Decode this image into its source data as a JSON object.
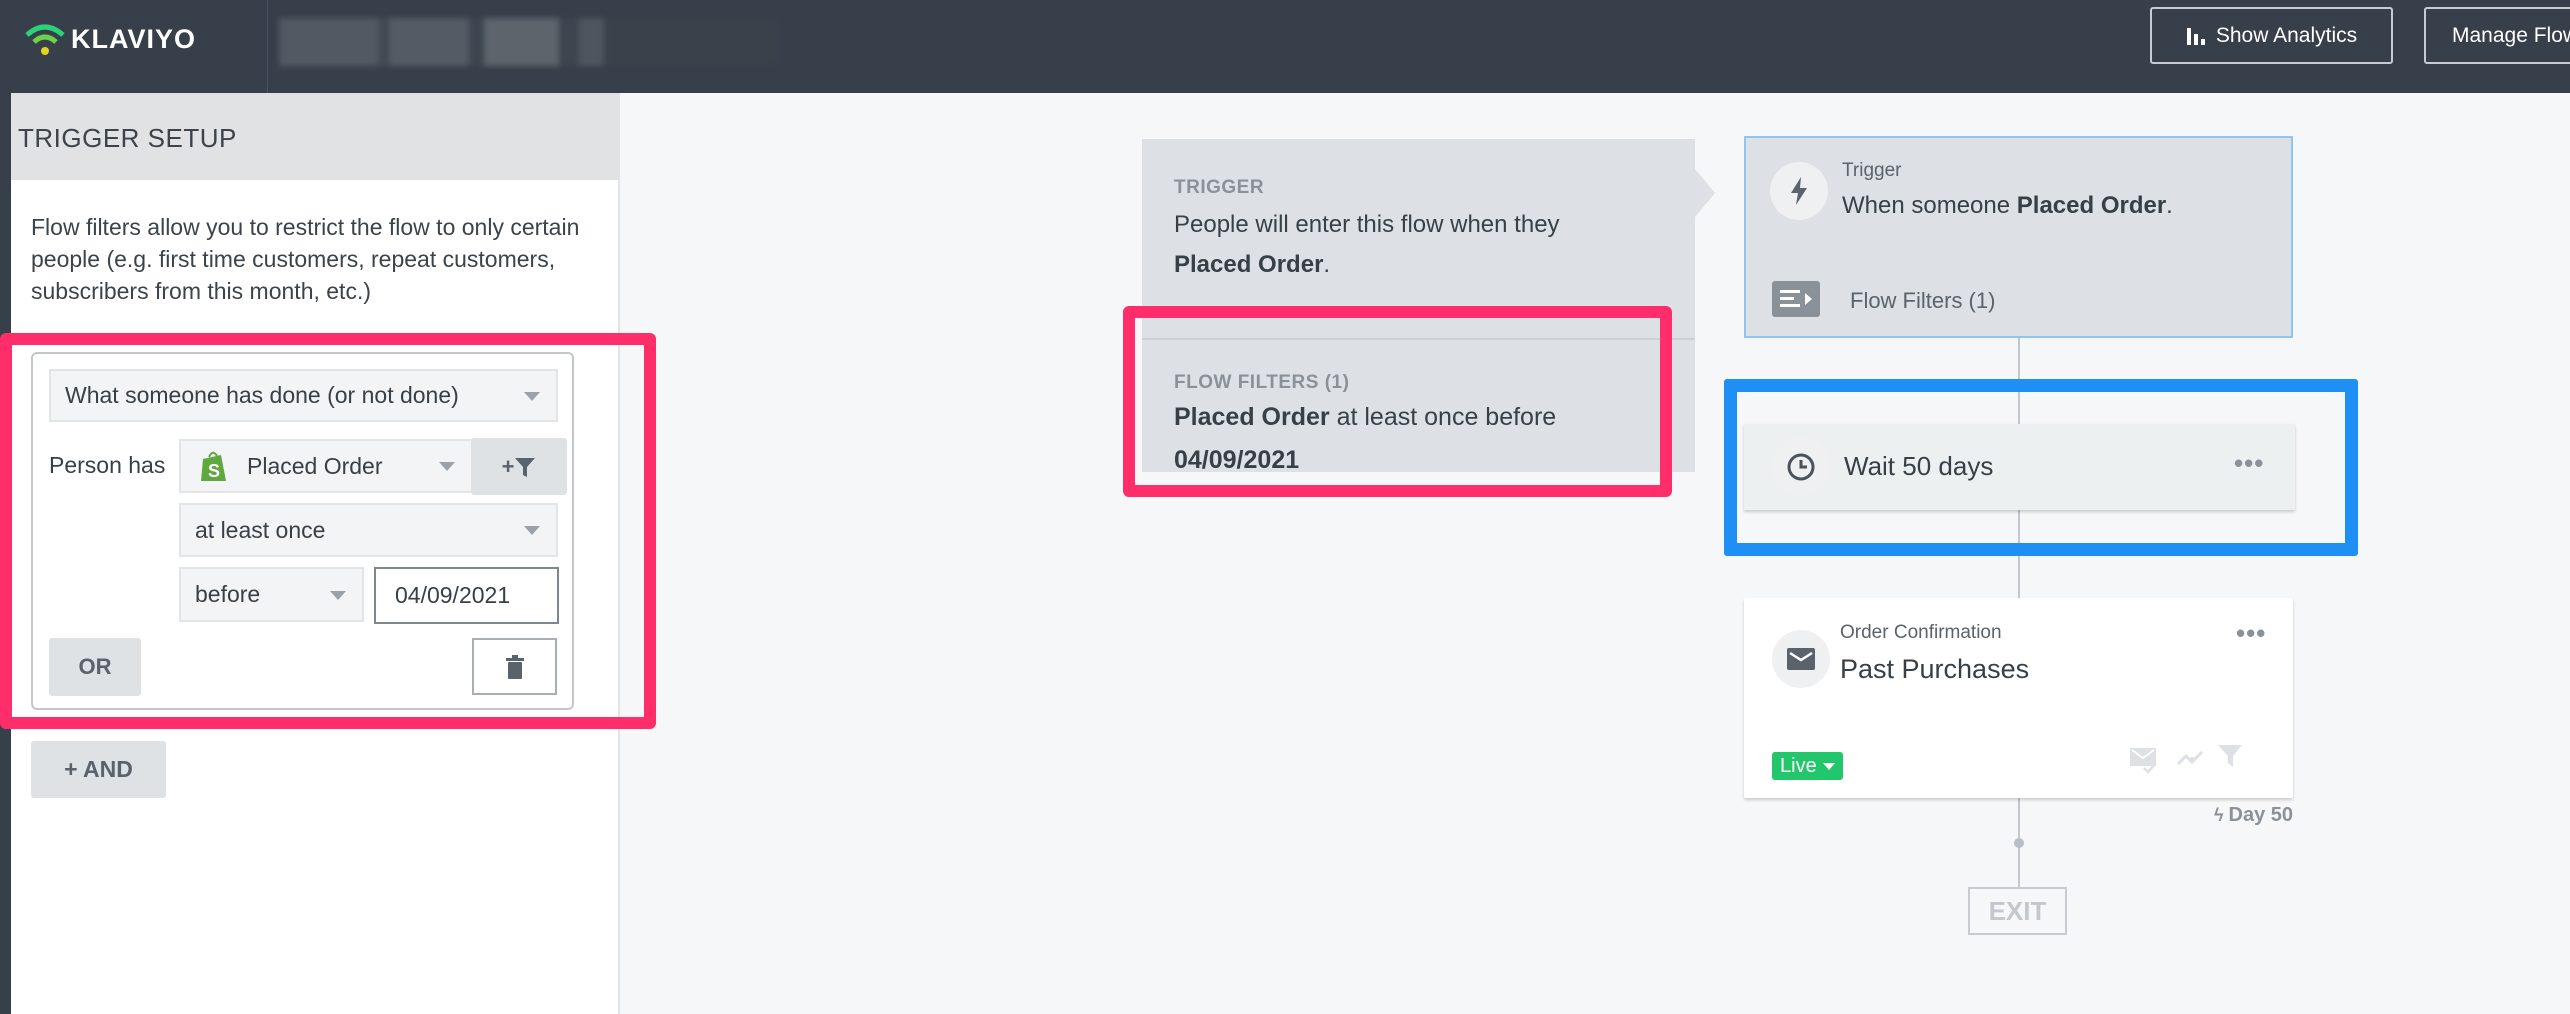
{
  "header": {
    "logo_text": "KLAVIYO",
    "show_analytics": "Show Analytics",
    "manage_flow": "Manage Flow"
  },
  "sidebar": {
    "title": "TRIGGER SETUP",
    "description": "Flow filters allow you to restrict the flow to only certain people (e.g. first time customers, repeat customers, subscribers from this month, etc.)",
    "filter": {
      "condition_type": "What someone has done (or not done)",
      "person_has_label": "Person has",
      "metric": "Placed Order",
      "add_filter_label": "+",
      "frequency": "at least once",
      "time_operator": "before",
      "date_value": "04/09/2021",
      "or_label": "OR"
    },
    "and_label": "+ AND"
  },
  "canvas": {
    "trigger_info": {
      "label": "TRIGGER",
      "text": "People will enter this flow when they",
      "metric": "Placed Order",
      "suffix": "."
    },
    "flow_filters_info": {
      "label": "FLOW FILTERS (1)",
      "metric": "Placed Order",
      "text": " at least once before",
      "date": "04/09/2021"
    },
    "trigger_node": {
      "label": "Trigger",
      "text": "When someone ",
      "metric": "Placed Order",
      "suffix": ".",
      "filters": "Flow Filters (1)"
    },
    "wait_node": {
      "text": "Wait 50 days",
      "menu": "•••"
    },
    "email_node": {
      "subtitle": "Order Confirmation",
      "title": "Past Purchases",
      "status": "Live",
      "menu": "•••",
      "day": "Day 50"
    },
    "exit_label": "EXIT"
  },
  "colors": {
    "highlight_pink": "#ff2e6b",
    "highlight_blue": "#1e8ff5",
    "live": "#22c66b",
    "topbar": "#373f4a"
  }
}
